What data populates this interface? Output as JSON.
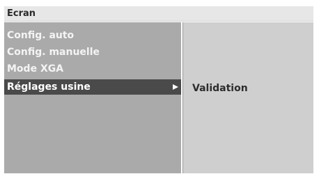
{
  "window": {
    "title": "Ecran"
  },
  "menu": {
    "items": [
      {
        "label": "Config. auto"
      },
      {
        "label": "Config. manuelle"
      },
      {
        "label": "Mode XGA"
      },
      {
        "label": "Réglages usine",
        "selected": true,
        "has_submenu": true
      }
    ]
  },
  "submenu": {
    "items": [
      {
        "label": "Validation"
      }
    ]
  },
  "colors": {
    "title_bar": "#e7e7e7",
    "left_panel": "#aaaaaa",
    "right_panel": "#cfcfcf",
    "selection": "#4a4a4a"
  },
  "icons": {
    "submenu_indicator": "arrow-right-icon"
  }
}
